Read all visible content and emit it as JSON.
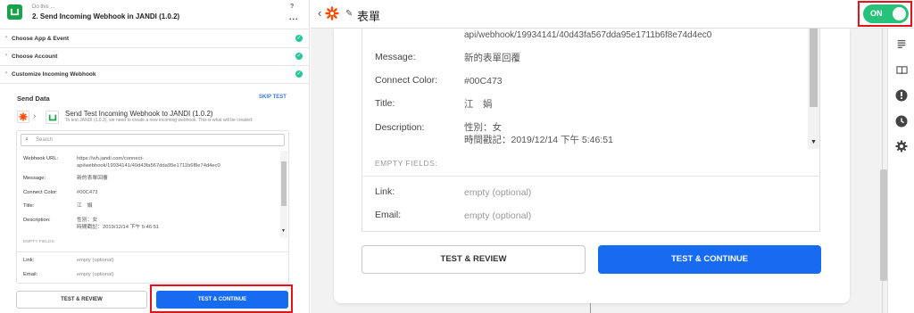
{
  "left": {
    "header": {
      "small": "Do this ...",
      "title": "2. Send Incoming Webhook in JANDI (1.0.2)",
      "help": "?",
      "more": "..."
    },
    "sections": [
      {
        "label": "Choose App & Event",
        "status": "✓"
      },
      {
        "label": "Choose Account",
        "status": "✓"
      },
      {
        "label": "Customize Incoming Webhook",
        "status": "✓"
      }
    ],
    "send_data": "Send Data",
    "skip_test": "SKIP TEST",
    "flow_title": "Send Test Incoming Webhook to JANDI (1.0.2)",
    "flow_sub": "To test JANDI (1.0.2), we need to create a new incoming webhook. This is what will be created:",
    "search_placeholder": "Search",
    "fields": {
      "webhook_label": "Webhook URL:",
      "webhook_value_1": "https://wh.jandi.com/connect-",
      "webhook_value_2": "api/webhook/19934141/40d43fa567dda95e1711b6f8e74d4ec0",
      "message_label": "Message:",
      "message_value": "新的表單回覆",
      "color_label": "Connect Color:",
      "color_value": "#00C473",
      "title_label": "Title:",
      "title_value": "江　娟",
      "desc_label": "Description:",
      "desc_value_1": "性別：女",
      "desc_value_2": "時間戳記：2019/12/14 下午 5:46:51",
      "empty_fields": "EMPTY FIELDS:",
      "link_label": "Link:",
      "link_value": "empty (optional)",
      "email_label": "Email:",
      "email_value": "empty (optional)"
    },
    "btn_review": "TEST & REVIEW",
    "btn_continue": "TEST & CONTINUE"
  },
  "right": {
    "back": "‹",
    "zap_name": "表單",
    "toggle": "ON",
    "url_tail": "api/webhook/19934141/40d43fa567dda95e1711b6f8e74d4ec0",
    "fields": {
      "message_label": "Message:",
      "message_value": "新的表單回覆",
      "color_label": "Connect Color:",
      "color_value": "#00C473",
      "title_label": "Title:",
      "title_value": "江　娟",
      "desc_label": "Description:",
      "desc_value_1": "性別：女",
      "desc_value_2": "時間戳記：2019/12/14 下午 5:46:51",
      "empty_fields": "EMPTY FIELDS:",
      "link_label": "Link:",
      "link_value": "empty (optional)",
      "email_label": "Email:",
      "email_value": "empty (optional)"
    },
    "btn_review": "TEST & REVIEW",
    "btn_continue": "TEST & CONTINUE",
    "sidebar_icons": [
      "list-icon",
      "book-icon",
      "alert-icon",
      "clock-icon",
      "gear-icon"
    ]
  },
  "colors": {
    "primary_blue": "#176bf0",
    "toggle_green": "#27c27a",
    "check_green": "#2ac59a",
    "highlight_red": "#e8101a",
    "zapier_orange": "#ff4a00",
    "jandi_green": "#16a34a"
  }
}
